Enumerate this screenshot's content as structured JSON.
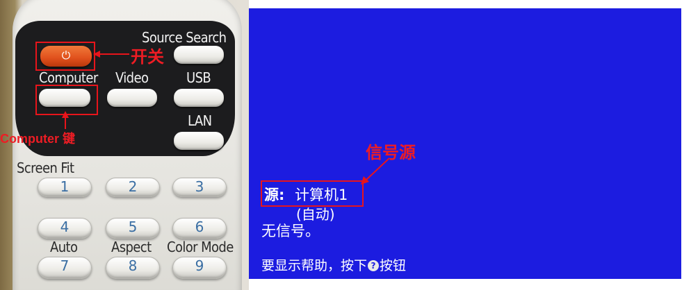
{
  "remote": {
    "source_search": "Source Search",
    "computer": "Computer",
    "video": "Video",
    "usb": "USB",
    "lan": "LAN",
    "screen_fit": "Screen Fit",
    "auto": "Auto",
    "aspect": "Aspect",
    "color_mode": "Color Mode",
    "power_symbol": "⏻",
    "numbers": [
      "1",
      "2",
      "3",
      "4",
      "5",
      "6",
      "7",
      "8",
      "9"
    ]
  },
  "annotations": {
    "power": "开关",
    "computer_key": "Computer 键",
    "signal_source": "信号源",
    "color": "#ee1c24"
  },
  "screen": {
    "source_label": "源:",
    "source_value": "计算机1",
    "auto": "(自动)",
    "no_signal": "无信号。",
    "help_prefix": "要显示帮助，按下",
    "help_suffix": "按钮",
    "background": "#1c1ce0"
  }
}
